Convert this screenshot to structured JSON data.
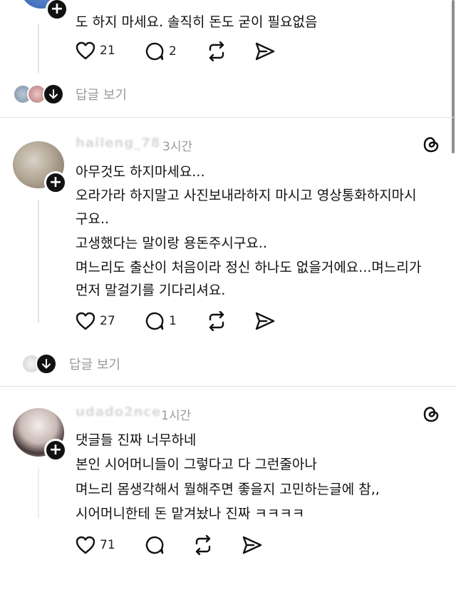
{
  "thread_top": {
    "partial_text": "도 하지 마세요. 솔직히 돈도 굳이 필요없음",
    "likes": "21",
    "replies": "2",
    "view_replies": "답글 보기"
  },
  "comment1": {
    "username": "haileng_78",
    "time": "3시간",
    "lines": [
      "아무것도 하지마세요...",
      "오라가라 하지말고 사진보내라하지 마시고 영상통화하지마시",
      "구요..",
      "고생했다는 말이랑 용돈주시구요..",
      "며느리도 출산이 처음이라 정신 하나도 없을거에요...며느리가",
      "먼저 말걸기를 기다리셔요."
    ],
    "likes": "27",
    "replies": "1",
    "view_replies": "답글 보기"
  },
  "comment2": {
    "username": "udado2nce",
    "time": "1시간",
    "lines": [
      "댓글들 진짜 너무하네",
      "본인 시어머니들이 그렇다고 다 그런줄아나",
      "며느리 몸생각해서 뭘해주면 좋을지 고민하는글에 참,,",
      "시어머니한테 돈 맡겨놨나 진짜 ㅋㅋㅋㅋ"
    ],
    "likes": "71"
  },
  "icons": {
    "like": "heart-icon",
    "reply": "comment-bubble-icon",
    "repost": "repost-icon",
    "share": "send-icon",
    "app": "threads-logo-icon"
  }
}
